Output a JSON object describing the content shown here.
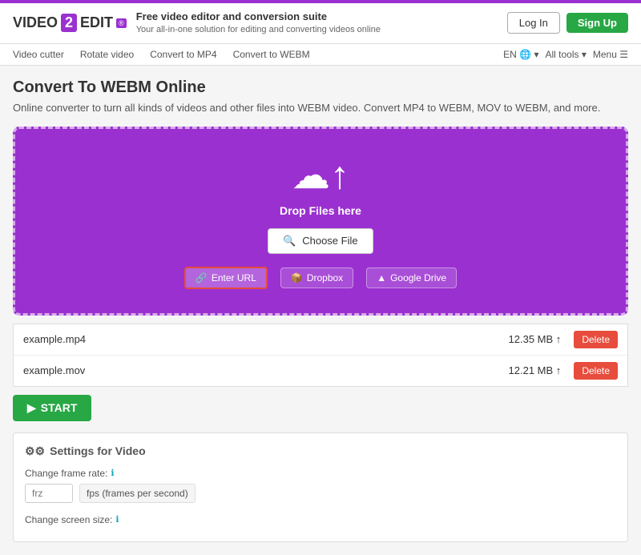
{
  "topbar": {
    "logo": {
      "prefix": "VIDEO",
      "number": "2",
      "suffix": "EDIT",
      "badge": "®"
    },
    "tagline": {
      "title": "Free video editor and conversion suite",
      "subtitle": "Your all-in-one solution for editing and converting videos online"
    },
    "login_label": "Log In",
    "signup_label": "Sign Up"
  },
  "nav": {
    "items": [
      {
        "label": "Video cutter"
      },
      {
        "label": "Rotate video"
      },
      {
        "label": "Convert to MP4"
      },
      {
        "label": "Convert to WEBM"
      }
    ],
    "language": "EN",
    "all_tools": "All tools",
    "menu": "Menu"
  },
  "page": {
    "title": "Convert To WEBM Online",
    "description": "Online converter to turn all kinds of videos and other files into WEBM video. Convert MP4 to WEBM, MOV to WEBM, and more."
  },
  "upload": {
    "drop_text": "Drop Files here",
    "choose_file": "Choose File",
    "enter_url": "Enter URL",
    "dropbox": "Dropbox",
    "google_drive": "Google Drive"
  },
  "files": [
    {
      "name": "example.mp4",
      "size": "12.35 MB"
    },
    {
      "name": "example.mov",
      "size": "12.21 MB"
    }
  ],
  "delete_label": "Delete",
  "start_label": "START",
  "settings": {
    "title": "Settings for Video",
    "frame_rate_label": "Change frame rate:",
    "frame_rate_placeholder": "frz",
    "frame_rate_hint": "fps (frames per second)",
    "screen_size_label": "Change screen size:"
  },
  "icons": {
    "gear": "⚙",
    "chevron_right": "›",
    "search": "🔍",
    "link": "🔗",
    "dropbox": "📦",
    "drive": "▲",
    "upload_arrow": "↑",
    "info": "ℹ",
    "play": "▶"
  }
}
